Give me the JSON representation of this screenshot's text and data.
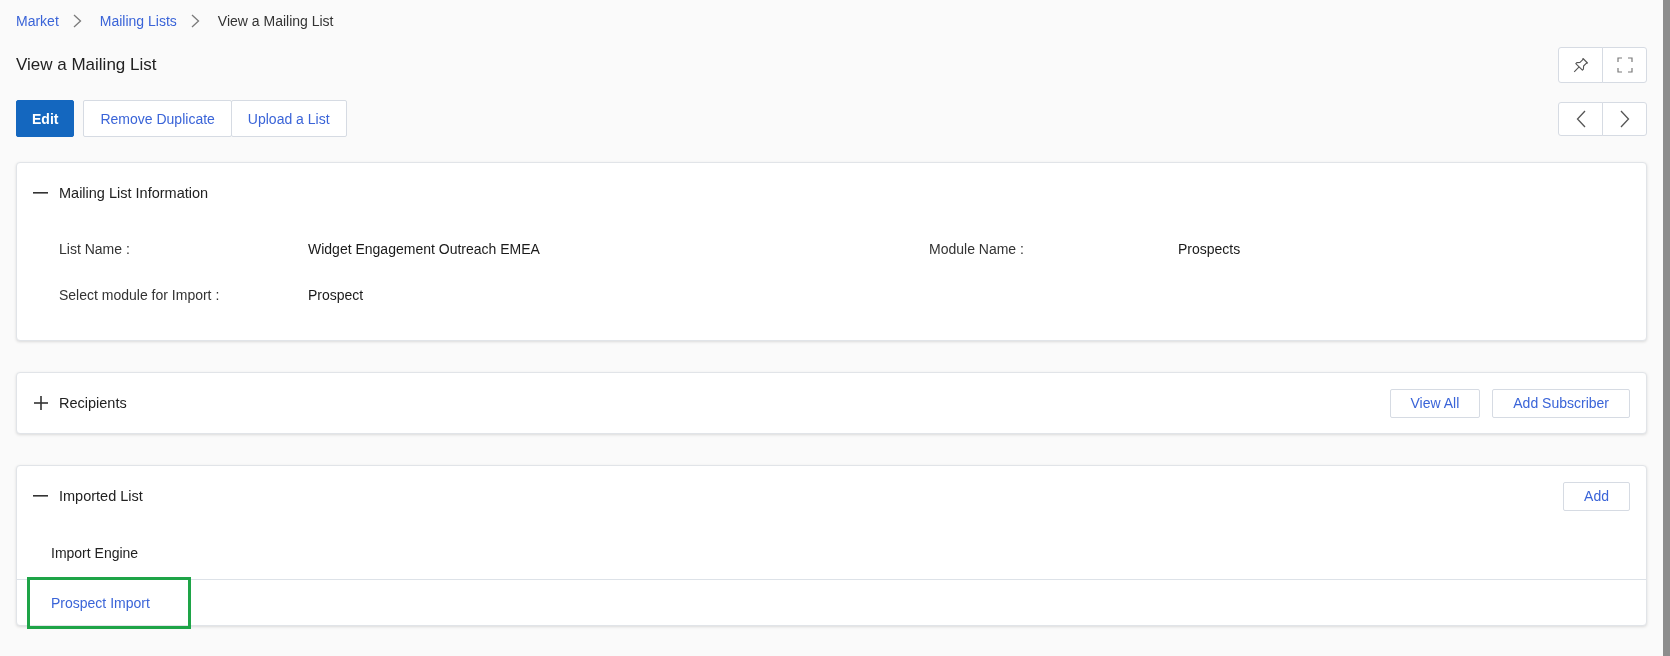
{
  "breadcrumb": [
    {
      "label": "Market",
      "current": false
    },
    {
      "label": "Mailing Lists",
      "current": false
    },
    {
      "label": "View a Mailing List",
      "current": true
    }
  ],
  "page_title": "View a Mailing List",
  "actions": [
    {
      "label": "Edit",
      "primary": true
    },
    {
      "label": "Remove Duplicate",
      "primary": false
    },
    {
      "label": "Upload a List",
      "primary": false
    }
  ],
  "panels": [
    {
      "title": "Mailing List Information",
      "expanded": true,
      "fields": [
        {
          "label": "List Name :",
          "value": "Widget Engagement Outreach EMEA"
        },
        {
          "label": "Module Name :",
          "value": "Prospects"
        },
        {
          "label": "Select module for Import :",
          "value": "Prospect"
        }
      ]
    },
    {
      "title": "Recipients",
      "expanded": false,
      "buttons": [
        "View All",
        "Add Subscriber"
      ]
    },
    {
      "title": "Imported List",
      "expanded": true,
      "buttons": [
        "Add"
      ],
      "table": {
        "columns": [
          "Import Engine"
        ],
        "rows": [
          {
            "cells": [
              "Prospect Import"
            ],
            "highlighted": true
          }
        ]
      }
    }
  ]
}
